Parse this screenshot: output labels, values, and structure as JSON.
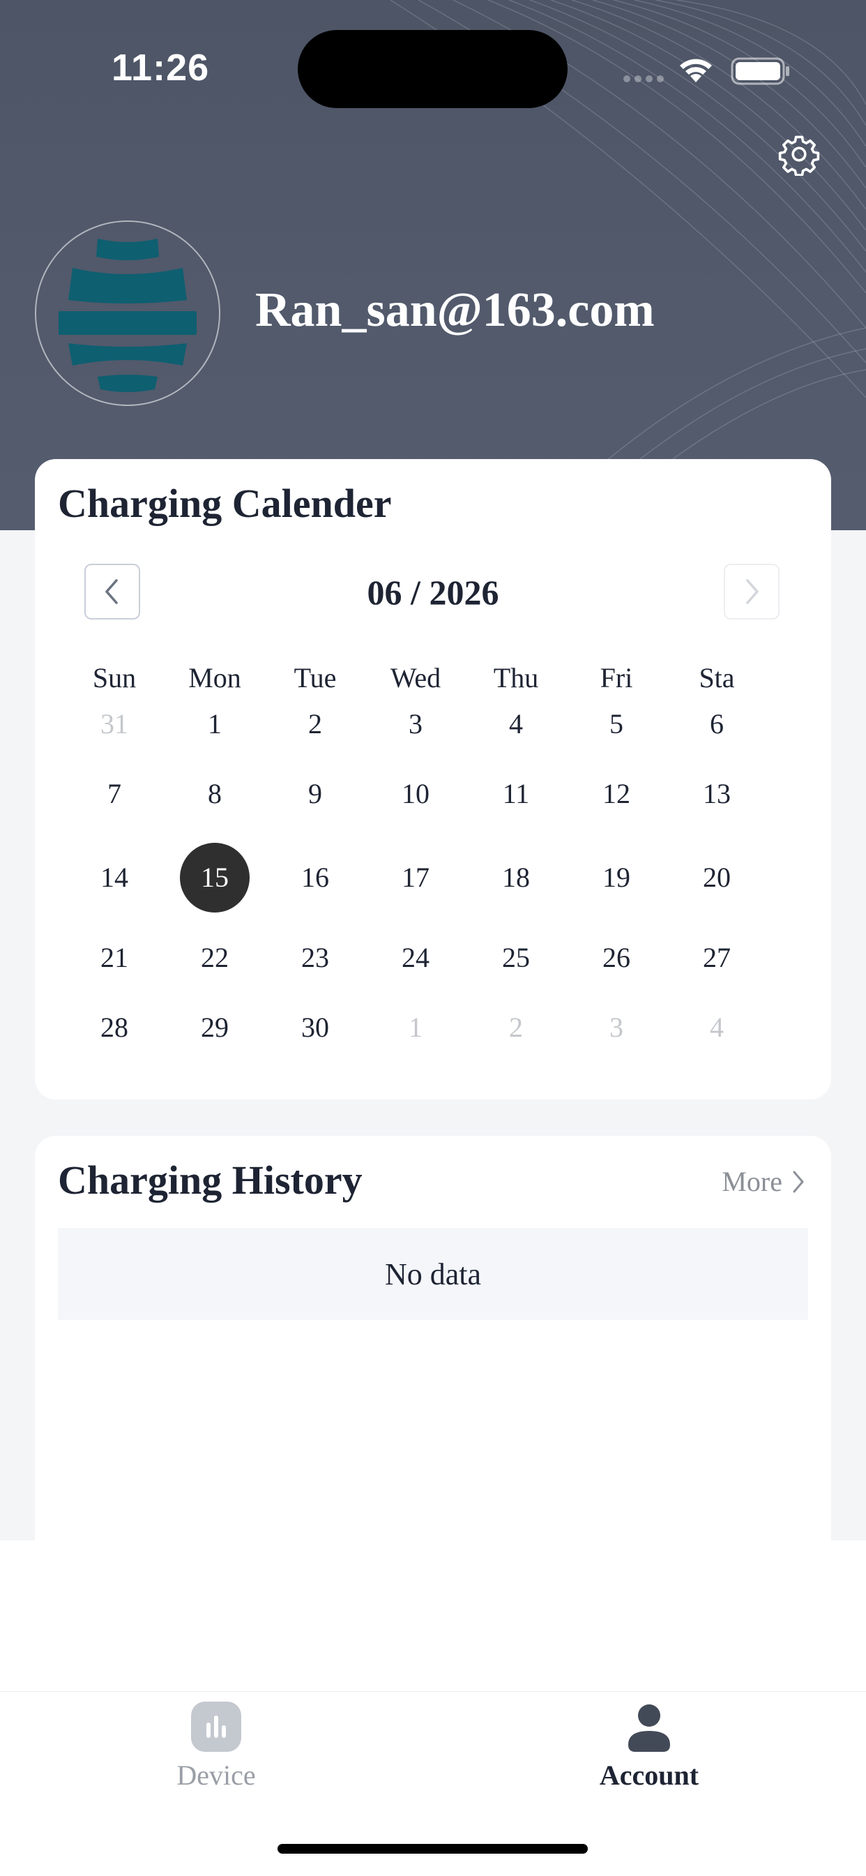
{
  "status_bar": {
    "time": "11:26"
  },
  "header": {
    "username": "Ran_san@163.com",
    "settings_icon": "gear-icon"
  },
  "calendar": {
    "title": "Charging Calender",
    "month_label": "06 / 2026",
    "weekdays": [
      "Sun",
      "Mon",
      "Tue",
      "Wed",
      "Thu",
      "Fri",
      "Sta"
    ],
    "weeks": [
      [
        {
          "d": "31",
          "muted": true
        },
        {
          "d": "1"
        },
        {
          "d": "2"
        },
        {
          "d": "3"
        },
        {
          "d": "4"
        },
        {
          "d": "5"
        },
        {
          "d": "6"
        }
      ],
      [
        {
          "d": "7"
        },
        {
          "d": "8"
        },
        {
          "d": "9"
        },
        {
          "d": "10"
        },
        {
          "d": "11"
        },
        {
          "d": "12"
        },
        {
          "d": "13"
        }
      ],
      [
        {
          "d": "14"
        },
        {
          "d": "15",
          "selected": true
        },
        {
          "d": "16"
        },
        {
          "d": "17"
        },
        {
          "d": "18"
        },
        {
          "d": "19"
        },
        {
          "d": "20"
        }
      ],
      [
        {
          "d": "21"
        },
        {
          "d": "22"
        },
        {
          "d": "23"
        },
        {
          "d": "24"
        },
        {
          "d": "25"
        },
        {
          "d": "26"
        },
        {
          "d": "27"
        }
      ],
      [
        {
          "d": "28"
        },
        {
          "d": "29"
        },
        {
          "d": "30"
        },
        {
          "d": "1",
          "muted": true
        },
        {
          "d": "2",
          "muted": true
        },
        {
          "d": "3",
          "muted": true
        },
        {
          "d": "4",
          "muted": true
        }
      ]
    ]
  },
  "history": {
    "title": "Charging History",
    "more_label": "More",
    "empty_text": "No data"
  },
  "tabbar": {
    "items": [
      {
        "label": "Device",
        "icon": "bar-chart-icon",
        "active": false
      },
      {
        "label": "Account",
        "icon": "person-icon",
        "active": true
      }
    ]
  },
  "colors": {
    "header_bg": "#4f5769",
    "accent_dark": "#2f2f2f",
    "logo_teal": "#0e5f70"
  }
}
